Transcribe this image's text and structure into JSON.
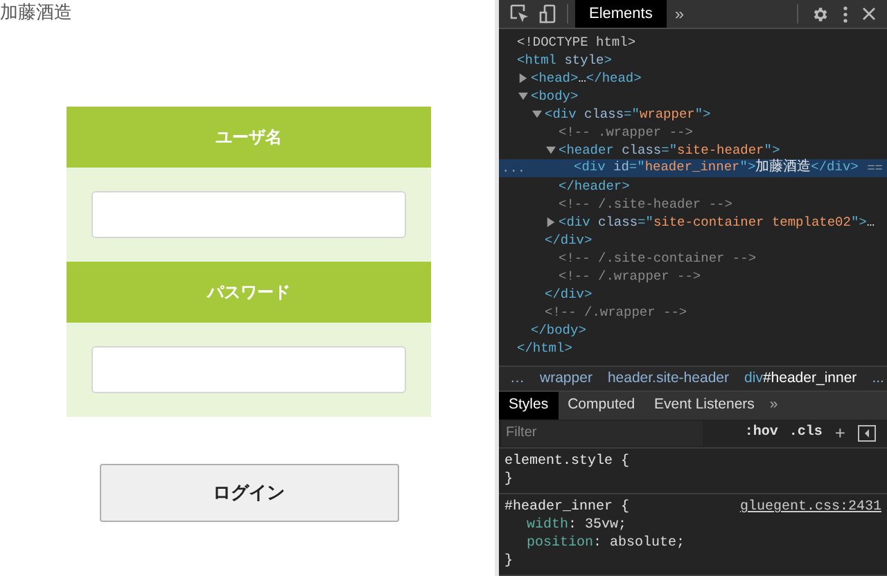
{
  "page": {
    "site_title": "加藤酒造",
    "fields": [
      {
        "label": "ユーザ名"
      },
      {
        "label": "パスワード"
      }
    ],
    "login_button": "ログイン"
  },
  "devtools": {
    "tabs": [
      {
        "label": "Elements",
        "selected": true
      }
    ],
    "more_tabs": "»",
    "tree": [
      {
        "selected": false,
        "parts": [
          {
            "kind": "doctype",
            "text": "<!DOCTYPE html>"
          }
        ]
      },
      {
        "selected": false,
        "parts": [
          {
            "kind": "tag",
            "text": "<html "
          },
          {
            "kind": "attr",
            "text": "style"
          },
          {
            "kind": "tag",
            "text": ">"
          }
        ],
        "children": [
          {
            "selected": false,
            "expanded": false,
            "parts": [
              {
                "kind": "tag",
                "text": "<head>"
              },
              {
                "kind": "text",
                "text": "…"
              },
              {
                "kind": "tag",
                "text": "</head>"
              }
            ]
          },
          {
            "selected": false,
            "expanded": true,
            "parts": [
              {
                "kind": "tag",
                "text": "<body>"
              }
            ],
            "children": [
              {
                "selected": false,
                "expanded": true,
                "parts": [
                  {
                    "kind": "tag",
                    "text": "<div "
                  },
                  {
                    "kind": "attr",
                    "text": "class"
                  },
                  {
                    "kind": "tag",
                    "text": "=\""
                  },
                  {
                    "kind": "value",
                    "text": "wrapper"
                  },
                  {
                    "kind": "tag",
                    "text": "\">"
                  }
                ],
                "children": [
                  {
                    "selected": false,
                    "parts": [
                      {
                        "kind": "comment",
                        "text": "<!-- .wrapper -->"
                      }
                    ]
                  },
                  {
                    "selected": false,
                    "expanded": true,
                    "parts": [
                      {
                        "kind": "tag",
                        "text": "<header "
                      },
                      {
                        "kind": "attr",
                        "text": "class"
                      },
                      {
                        "kind": "tag",
                        "text": "=\""
                      },
                      {
                        "kind": "value",
                        "text": "site-header"
                      },
                      {
                        "kind": "tag",
                        "text": "\">"
                      }
                    ],
                    "children": [
                      {
                        "selected": true,
                        "gutter": "...",
                        "badge": "==",
                        "parts": [
                          {
                            "kind": "tag",
                            "text": "<div "
                          },
                          {
                            "kind": "attr",
                            "text": "id"
                          },
                          {
                            "kind": "tag",
                            "text": "=\""
                          },
                          {
                            "kind": "value",
                            "text": "header_inner"
                          },
                          {
                            "kind": "tag",
                            "text": "\">"
                          },
                          {
                            "kind": "text",
                            "text": "加藤酒造"
                          },
                          {
                            "kind": "tag",
                            "text": "</div>"
                          }
                        ]
                      }
                    ]
                  },
                  {
                    "selected": false,
                    "parts": [
                      {
                        "kind": "tag",
                        "text": "</header>"
                      }
                    ]
                  },
                  {
                    "selected": false,
                    "parts": [
                      {
                        "kind": "comment",
                        "text": "<!-- /.site-header -->"
                      }
                    ]
                  },
                  {
                    "selected": false,
                    "expanded": false,
                    "parts": [
                      {
                        "kind": "tag",
                        "text": "<div "
                      },
                      {
                        "kind": "attr",
                        "text": "class"
                      },
                      {
                        "kind": "tag",
                        "text": "=\""
                      },
                      {
                        "kind": "value",
                        "text": "site-container template02"
                      },
                      {
                        "kind": "tag",
                        "text": "\">"
                      },
                      {
                        "kind": "text",
                        "text": "…"
                      }
                    ]
                  }
                ]
              },
              {
                "selected": false,
                "parts": [
                  {
                    "kind": "tag",
                    "text": "</div>"
                  }
                ],
                "children": [
                  {
                    "selected": false,
                    "parts": [
                      {
                        "kind": "comment",
                        "text": "<!-- /.site-container -->"
                      }
                    ]
                  },
                  {
                    "selected": false,
                    "parts": [
                      {
                        "kind": "comment",
                        "text": "<!-- /.wrapper -->"
                      }
                    ]
                  }
                ]
              },
              {
                "selected": false,
                "parts": [
                  {
                    "kind": "tag",
                    "text": "</div>"
                  }
                ]
              },
              {
                "selected": false,
                "parts": [
                  {
                    "kind": "comment",
                    "text": "<!-- /.wrapper -->"
                  }
                ]
              }
            ]
          },
          {
            "selected": false,
            "parts": [
              {
                "kind": "tag",
                "text": "</body>"
              }
            ]
          }
        ]
      },
      {
        "selected": false,
        "parts": [
          {
            "kind": "tag",
            "text": "</html>"
          }
        ]
      }
    ],
    "breadcrumbs": [
      {
        "text": "…",
        "selected": false
      },
      {
        "text": "wrapper",
        "selected": false
      },
      {
        "text": "header.site-header",
        "selected": false
      },
      {
        "lead": "div",
        "text": "#header_inner",
        "selected": true
      },
      {
        "text": "...",
        "selected": false
      }
    ],
    "style_tabs": [
      {
        "label": "Styles",
        "selected": true
      },
      {
        "label": "Computed",
        "selected": false
      },
      {
        "label": "Event Listeners",
        "selected": false
      }
    ],
    "style_more": "»",
    "filter": {
      "placeholder": "Filter"
    },
    "hov": ":hov",
    "cls": ".cls",
    "plus": "+",
    "rules": [
      {
        "selector": "element.style {",
        "close": "}"
      },
      {
        "selector": "#header_inner {",
        "source": "gluegent.css:2431",
        "declarations": [
          {
            "property": "width",
            "value": ": 35vw;"
          },
          {
            "property": "position",
            "value": ": absolute;"
          }
        ],
        "close": "}"
      }
    ]
  }
}
